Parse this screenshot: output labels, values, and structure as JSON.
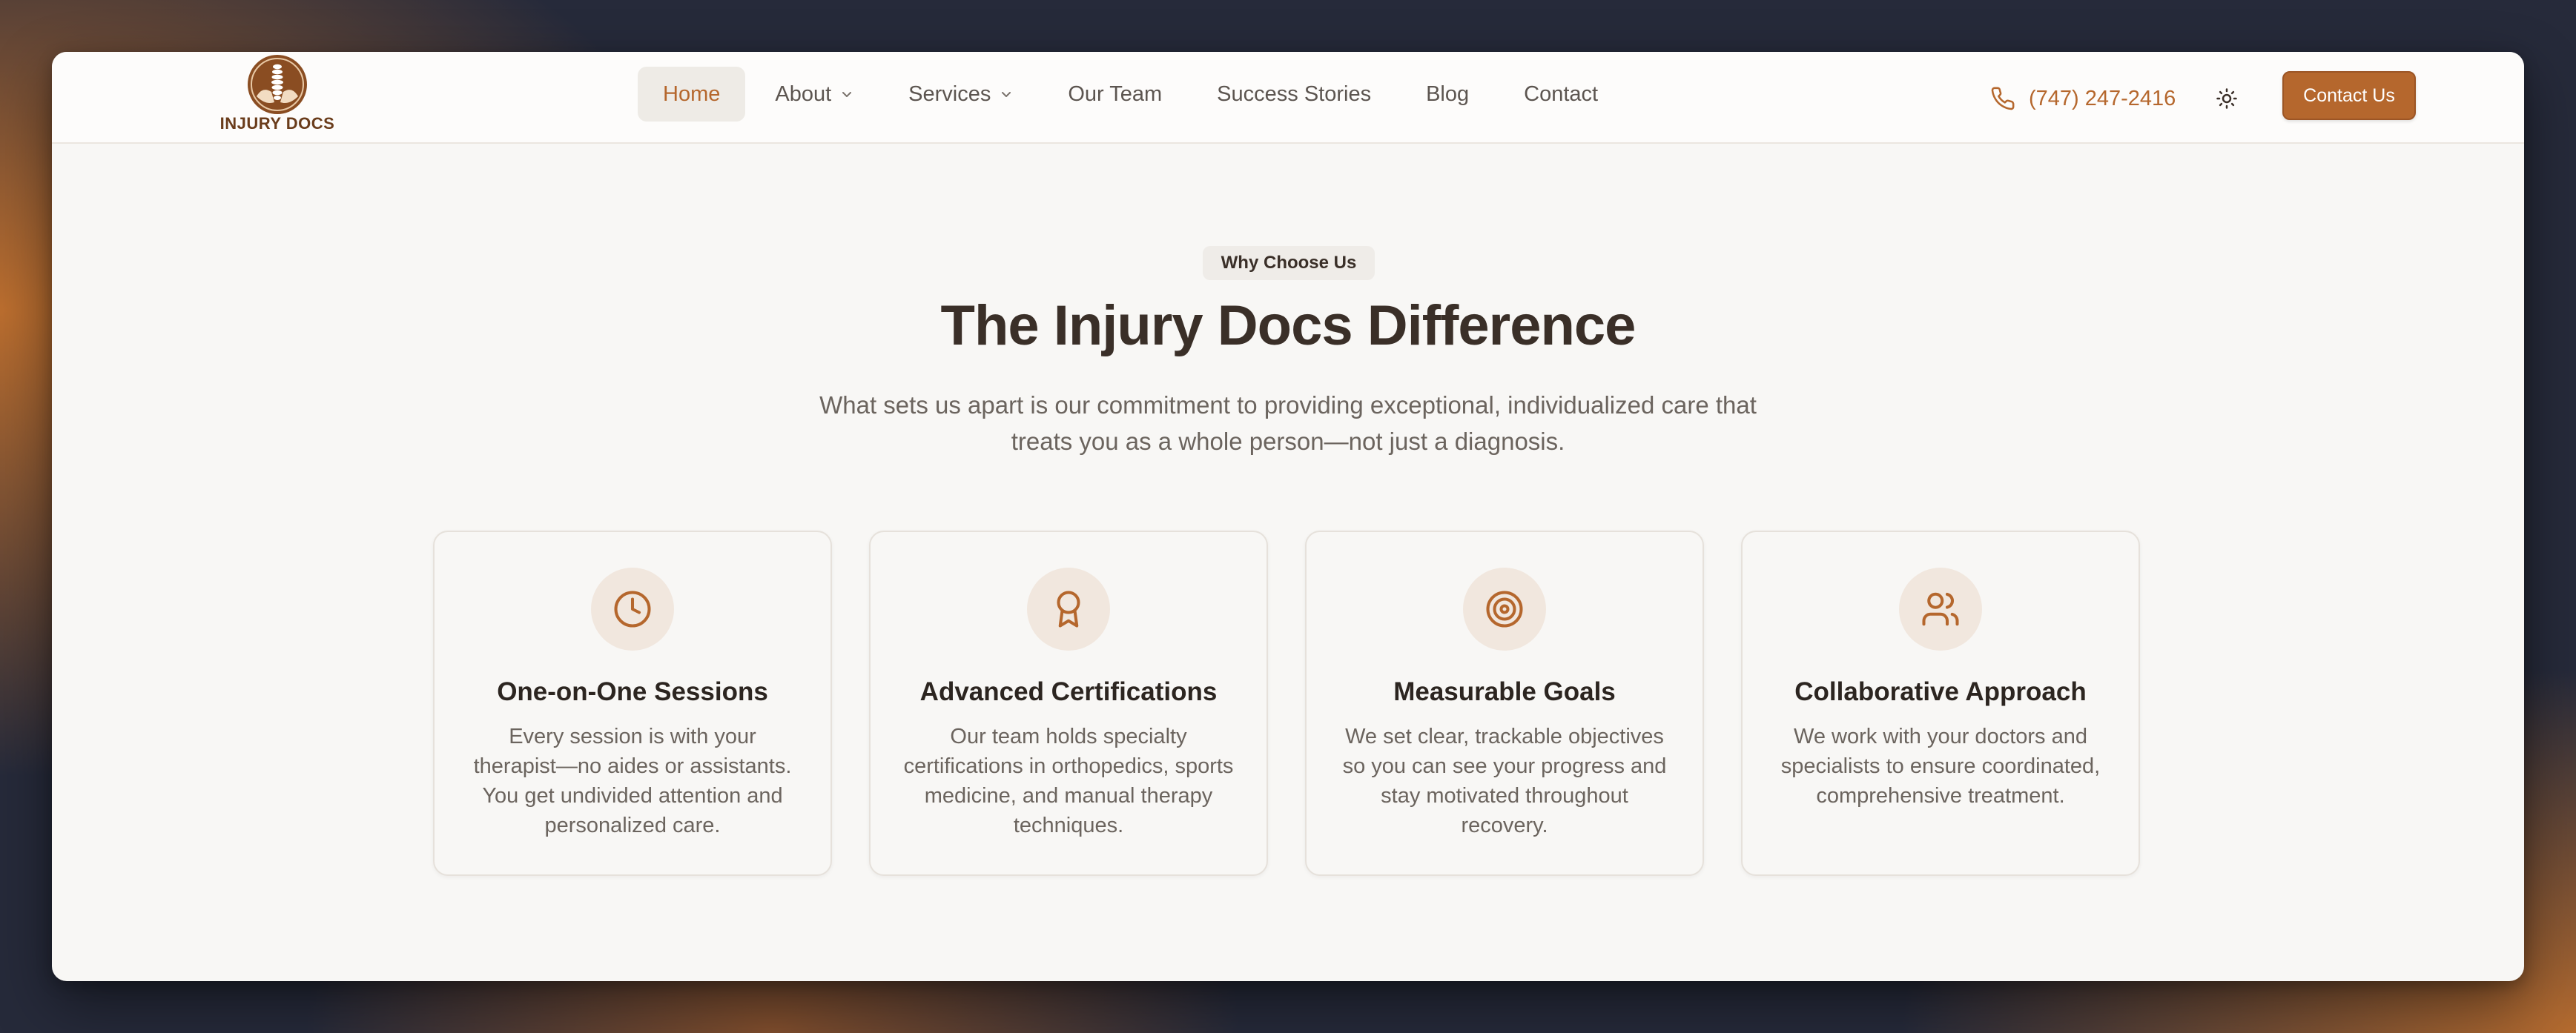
{
  "brand": {
    "name": "INJURY DOCS",
    "accent": "#b5672d",
    "dark_text": "#3a2f28",
    "muted_text": "#6b645e"
  },
  "nav": {
    "items": [
      {
        "label": "Home",
        "active": true,
        "has_dropdown": false
      },
      {
        "label": "About",
        "active": false,
        "has_dropdown": true
      },
      {
        "label": "Services",
        "active": false,
        "has_dropdown": true
      },
      {
        "label": "Our Team",
        "active": false,
        "has_dropdown": false
      },
      {
        "label": "Success Stories",
        "active": false,
        "has_dropdown": false
      },
      {
        "label": "Blog",
        "active": false,
        "has_dropdown": false
      },
      {
        "label": "Contact",
        "active": false,
        "has_dropdown": false
      }
    ]
  },
  "header": {
    "phone": "(747) 247-2416",
    "phone_icon": "phone-icon",
    "theme_icon": "sun-icon",
    "cta_label": "Contact Us"
  },
  "hero": {
    "eyebrow": "Why Choose Us",
    "title": "The Injury Docs Difference",
    "subtitle": "What sets us apart is our commitment to providing exceptional, individualized care that treats you as a whole person—not just a diagnosis."
  },
  "features": [
    {
      "icon": "clock-icon",
      "title": "One-on-One Sessions",
      "description": "Every session is with your therapist—no aides or assistants. You get undivided attention and personalized care."
    },
    {
      "icon": "award-icon",
      "title": "Advanced Certifications",
      "description": "Our team holds specialty certifications in orthopedics, sports medicine, and manual therapy techniques."
    },
    {
      "icon": "target-icon",
      "title": "Measurable Goals",
      "description": "We set clear, trackable objectives so you can see your progress and stay motivated throughout recovery."
    },
    {
      "icon": "users-icon",
      "title": "Collaborative Approach",
      "description": "We work with your doctors and specialists to ensure coordinated, comprehensive treatment."
    }
  ]
}
